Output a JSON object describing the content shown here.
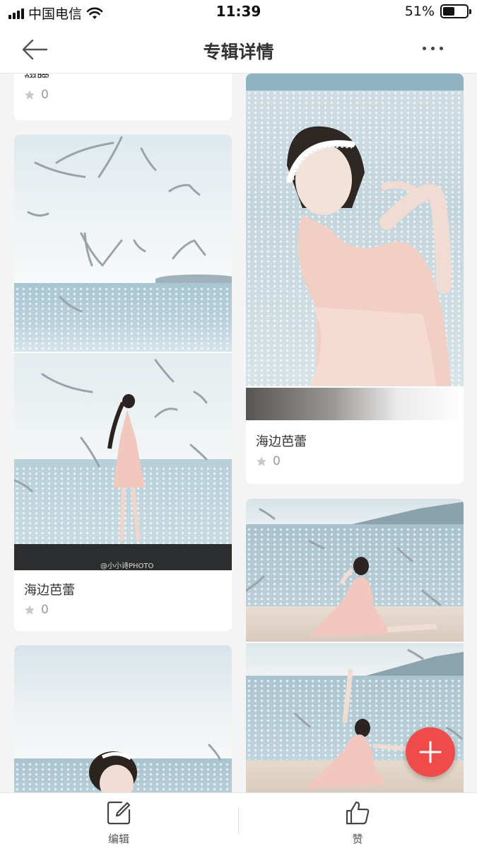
{
  "status_bar": {
    "carrier": "中国电信",
    "time": "11:39",
    "battery": "51%",
    "battery_level": 0.51
  },
  "nav": {
    "title": "专辑详情",
    "back_icon": "arrow-left-icon",
    "more_icon": "more-dots-icon"
  },
  "left_column": {
    "card1": {
      "title": "翅膀",
      "likes": "0"
    },
    "card2": {
      "title": "海边芭蕾",
      "likes": "0",
      "watermark": "@小小诗PHOTO"
    },
    "card3": {
      "title": "",
      "likes": ""
    }
  },
  "right_column": {
    "card1": {
      "title": "海边芭蕾",
      "likes": "0"
    },
    "card2": {
      "title": "",
      "likes": ""
    }
  },
  "fab": {
    "icon": "plus-icon"
  },
  "bottom_bar": {
    "edit_label": "编辑",
    "edit_icon": "edit-icon",
    "like_label": "赞",
    "like_icon": "thumbs-up-icon"
  },
  "colors": {
    "accent": "#f04b4b",
    "star": "#c8c8c8"
  }
}
